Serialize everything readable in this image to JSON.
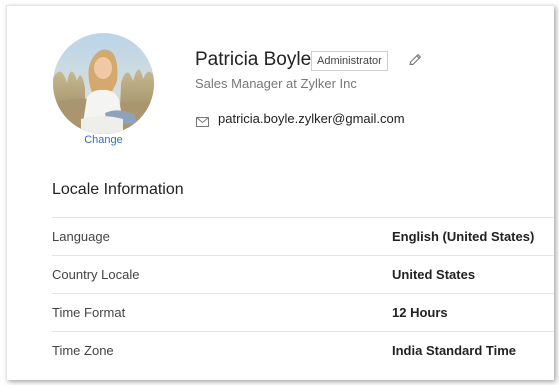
{
  "profile": {
    "name": "Patricia Boyle",
    "role": "Administrator",
    "job_title": "Sales Manager at Zylker Inc",
    "email": "patricia.boyle.zylker@gmail.com",
    "change_label": "Change",
    "avatar_icon": "user-photo",
    "edit_icon": "pencil-icon",
    "email_icon": "envelope-icon"
  },
  "locale": {
    "title": "Locale Information",
    "rows": [
      {
        "label": "Language",
        "value": "English (United States)"
      },
      {
        "label": "Country Locale",
        "value": "United States"
      },
      {
        "label": "Time Format",
        "value": "12 Hours"
      },
      {
        "label": "Time Zone",
        "value": "India Standard Time"
      }
    ]
  },
  "colors": {
    "link": "#2f6fc0",
    "text": "#222222",
    "muted": "#777777",
    "divider": "#e4e4e4"
  }
}
